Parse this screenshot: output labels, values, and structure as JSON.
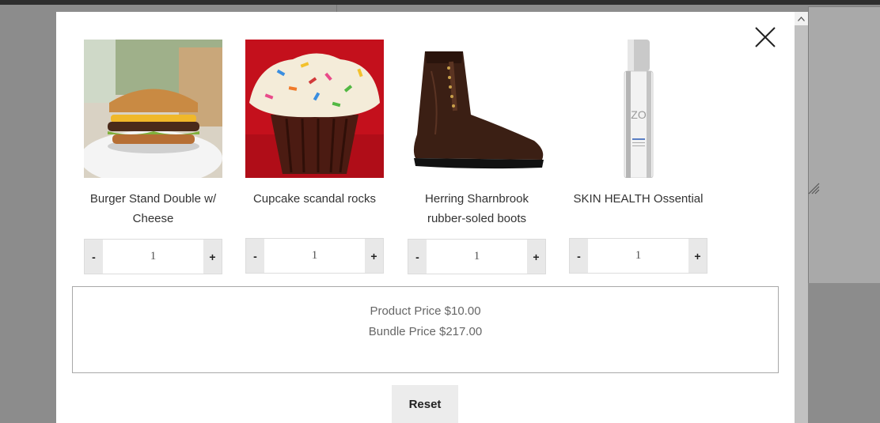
{
  "products": [
    {
      "name": "Burger Stand Double w/ Cheese",
      "quantity": "1",
      "image_icon": "burger-image"
    },
    {
      "name": "Cupcake scandal rocks",
      "quantity": "1",
      "image_icon": "cupcake-image"
    },
    {
      "name": "Herring Sharnbrook rubber-soled boots",
      "quantity": "1",
      "image_icon": "boot-image"
    },
    {
      "name": "SKIN HEALTH Ossential",
      "quantity": "1",
      "image_icon": "skincare-bottle-image"
    }
  ],
  "qty_controls": {
    "minus": "-",
    "plus": "+"
  },
  "pricing": {
    "product_price": "Product Price $10.00",
    "bundle_price": "Bundle Price $217.00"
  },
  "reset_label": "Reset",
  "colors": {
    "overlay": "#8c8c8c",
    "modal": "#ffffff",
    "button_bg": "#ececec"
  }
}
